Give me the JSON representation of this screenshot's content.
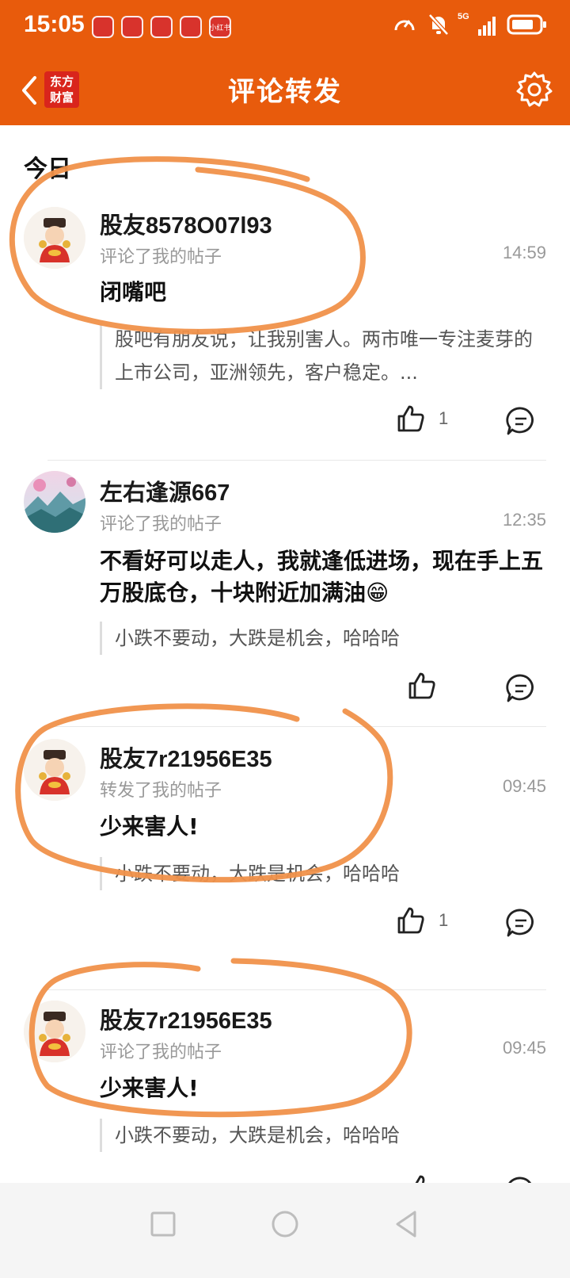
{
  "status_bar": {
    "time": "15:05",
    "notifications": [
      "",
      "",
      "",
      "",
      "小红书"
    ],
    "network": "5G",
    "icons": [
      "speedometer-icon",
      "mute-bell-icon",
      "signal-icon",
      "battery-icon"
    ]
  },
  "header": {
    "title": "评论转发",
    "brand_logo_line1": "东方",
    "brand_logo_line2": "财富",
    "accent": "#e85b0c"
  },
  "section_label": "今日",
  "items": [
    {
      "username": "股友8578O07l93",
      "action": "评论了我的帖子",
      "time": "14:59",
      "comment": "闭嘴吧",
      "quote": "股吧有朋友说，让我别害人。两市唯一专注麦芽的上市公司，亚洲领先，客户稳定。...",
      "likes": "1"
    },
    {
      "username": "左右逢源667",
      "action": "评论了我的帖子",
      "time": "12:35",
      "comment": "不看好可以走人，我就逢低进场，现在手上五万股底仓，十块附近加满油😁",
      "quote": "小跌不要动，大跌是机会，哈哈哈",
      "likes": ""
    },
    {
      "username": "股友7r21956E35",
      "action": "转发了我的帖子",
      "time": "09:45",
      "comment": "少来害人!",
      "quote": "小跌不要动，大跌是机会，哈哈哈",
      "likes": "1"
    },
    {
      "username": "股友7r21956E35",
      "action": "评论了我的帖子",
      "time": "09:45",
      "comment": "少来害人!",
      "quote": "小跌不要动，大跌是机会，哈哈哈",
      "likes": ""
    }
  ]
}
